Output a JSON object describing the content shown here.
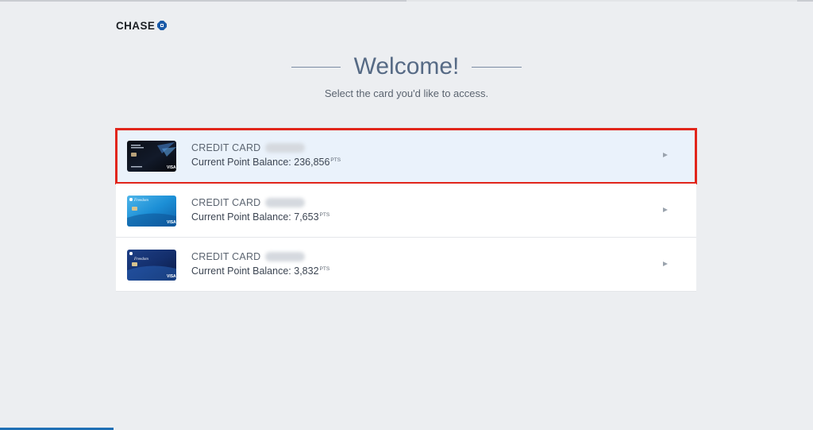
{
  "brand": {
    "name": "CHASE",
    "logo_icon": "chase-octagon-icon",
    "color": "#1a5aa8"
  },
  "welcome": {
    "title": "Welcome!",
    "subtitle": "Select the card you'd like to access."
  },
  "cards": [
    {
      "name": "CREDIT CARD",
      "balance_label": "Current Point Balance: 236,856",
      "pts_label": "PTS",
      "image": "sapphire-reserve-card",
      "selected": true
    },
    {
      "name": "CREDIT CARD",
      "balance_label": "Current Point Balance: 7,653",
      "pts_label": "PTS",
      "image": "freedom-card",
      "selected": false
    },
    {
      "name": "CREDIT CARD",
      "balance_label": "Current Point Balance: 3,832",
      "pts_label": "PTS",
      "image": "freedom-unlimited-card",
      "selected": false
    }
  ],
  "colors": {
    "highlight_outline": "#e1251b",
    "selected_row_bg": "#eaf2fb",
    "page_bg": "#eceef1"
  }
}
